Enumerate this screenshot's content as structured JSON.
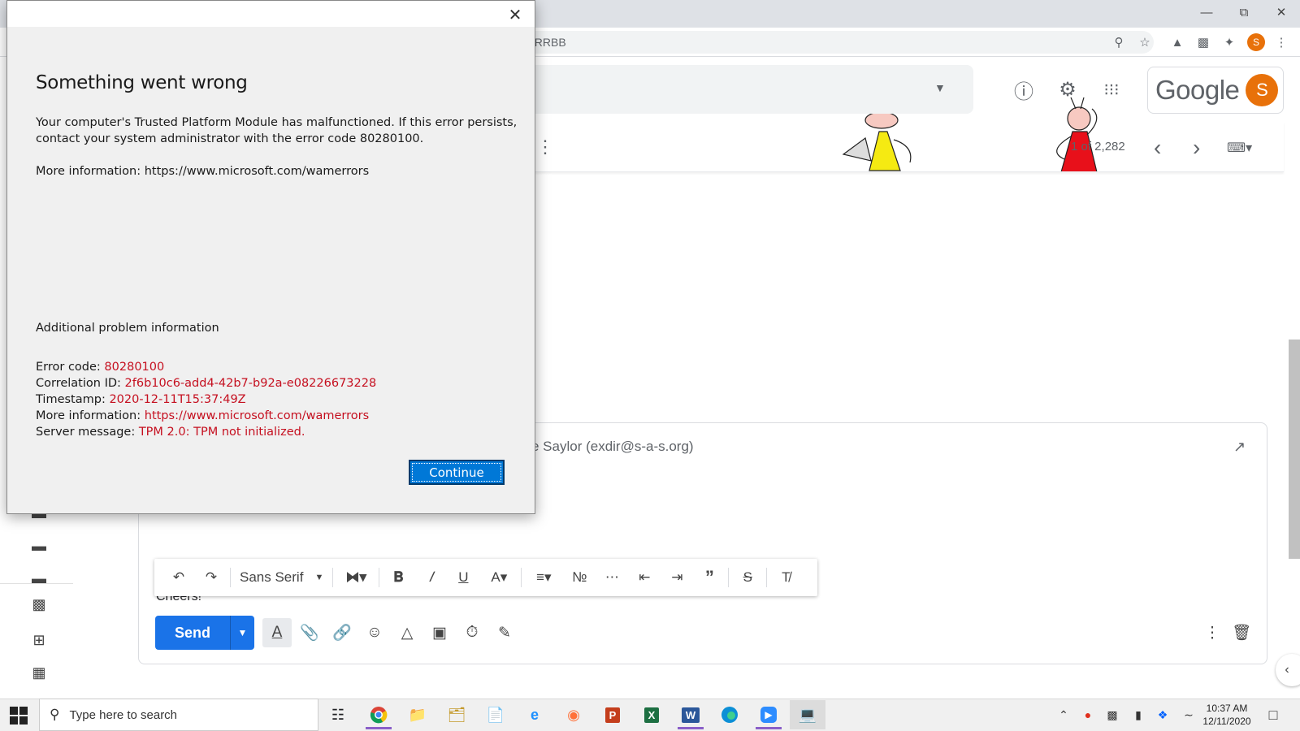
{
  "browser": {
    "url_fragment": "gRRBB",
    "profile_letter": "S"
  },
  "gmail": {
    "brand": "Google",
    "avatar_letter": "S",
    "pager": "1 of 2,282",
    "compose": {
      "from_text": "e Saylor (exdir@s-a-s.org)",
      "body_text": "Cheers!",
      "send_label": "Send",
      "font_name": "Sans Serif"
    }
  },
  "dialog": {
    "title": "Something went wrong",
    "message_line1": "Your computer's Trusted Platform Module has malfunctioned. If this error persists,",
    "message_line2": "contact your system administrator with the error code 80280100.",
    "more_info": "More information: https://www.microsoft.com/wamerrors",
    "additional_heading": "Additional problem information",
    "details": [
      {
        "label": "Error code: ",
        "value": "80280100"
      },
      {
        "label": "Correlation ID: ",
        "value": "2f6b10c6-add4-42b7-b92a-e08226673228"
      },
      {
        "label": "Timestamp: ",
        "value": "2020-12-11T15:37:49Z"
      },
      {
        "label": "More information: ",
        "value": "https://www.microsoft.com/wamerrors"
      },
      {
        "label": "Server message: ",
        "value": "TPM 2.0: TPM not initialized."
      }
    ],
    "continue_label": "Continue"
  },
  "taskbar": {
    "search_placeholder": "Type here to search",
    "time": "10:37 AM",
    "date": "12/11/2020"
  },
  "colors": {
    "gmail_blue": "#1a73e8",
    "error_red": "#c50f1f",
    "win_blue": "#0078d7",
    "avatar_orange": "#e8710a"
  }
}
